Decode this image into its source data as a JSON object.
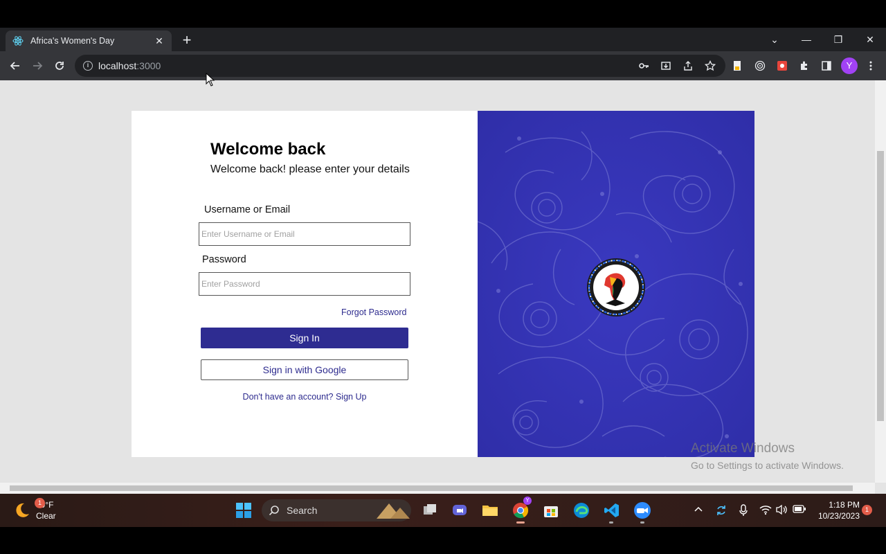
{
  "browser": {
    "tab_title": "Africa's Women's Day",
    "url_host": "localhost",
    "url_port": ":3000",
    "profile_initial": "Y"
  },
  "login": {
    "heading": "Welcome back",
    "subheading": "Welcome back! please enter your details",
    "username_label": "Username or Email",
    "username_placeholder": "Enter Username or Email",
    "password_label": "Password",
    "password_placeholder": "Enter Password",
    "forgot_link": "Forgot Password",
    "signin_button": "Sign In",
    "google_button": "Sign in with Google",
    "signup_link": "Don't have an account? Sign Up"
  },
  "logo": {
    "top_text": "AFRICA'S WOMEN DAY",
    "bottom_text": "31ST JULY"
  },
  "watermark": {
    "line1": "Activate Windows",
    "line2": "Go to Settings to activate Windows."
  },
  "taskbar": {
    "weather_temp": "79°F",
    "weather_desc": "Clear",
    "weather_badge": "1",
    "search_label": "Search",
    "time": "1:18 PM",
    "date": "10/23/2023",
    "notification_count": "1"
  },
  "colors": {
    "accent": "#2e2c91",
    "panel_blue": "#3634b8"
  }
}
